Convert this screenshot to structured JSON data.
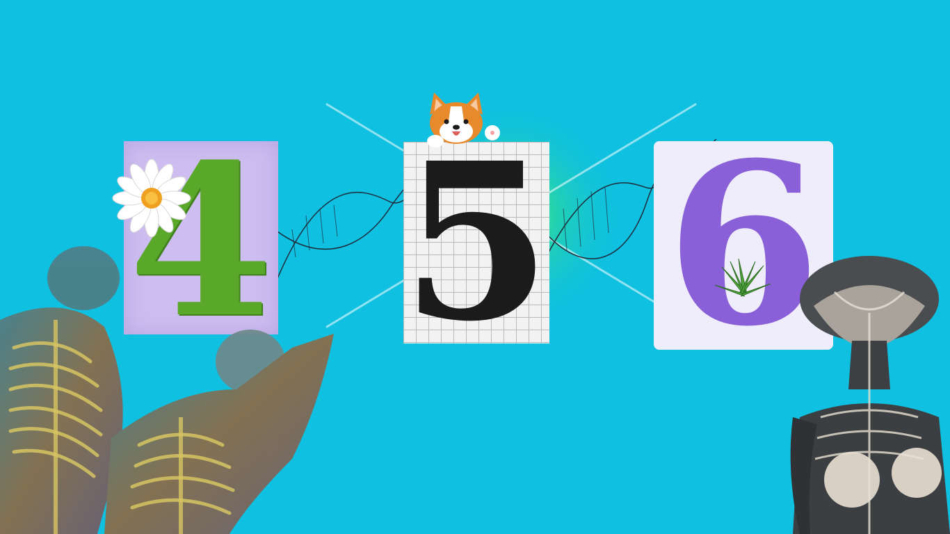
{
  "numbers": {
    "first": "4",
    "second": "5",
    "third": "6"
  },
  "colors": {
    "background": "#0fc0e0",
    "four_card": "#cdbdf0",
    "four_digit": "#5aa82a",
    "five_digit": "#1b1b1b",
    "six_card": "#efedfb",
    "six_digit": "#8a60d9"
  },
  "decorations": {
    "left": "daisy-flower-icon",
    "center": "corgi-dog-icon",
    "right": "aloe-plant-icon",
    "connectors": "dna-helix",
    "figures": [
      "anatomical-body-left",
      "xray-body-right"
    ]
  }
}
